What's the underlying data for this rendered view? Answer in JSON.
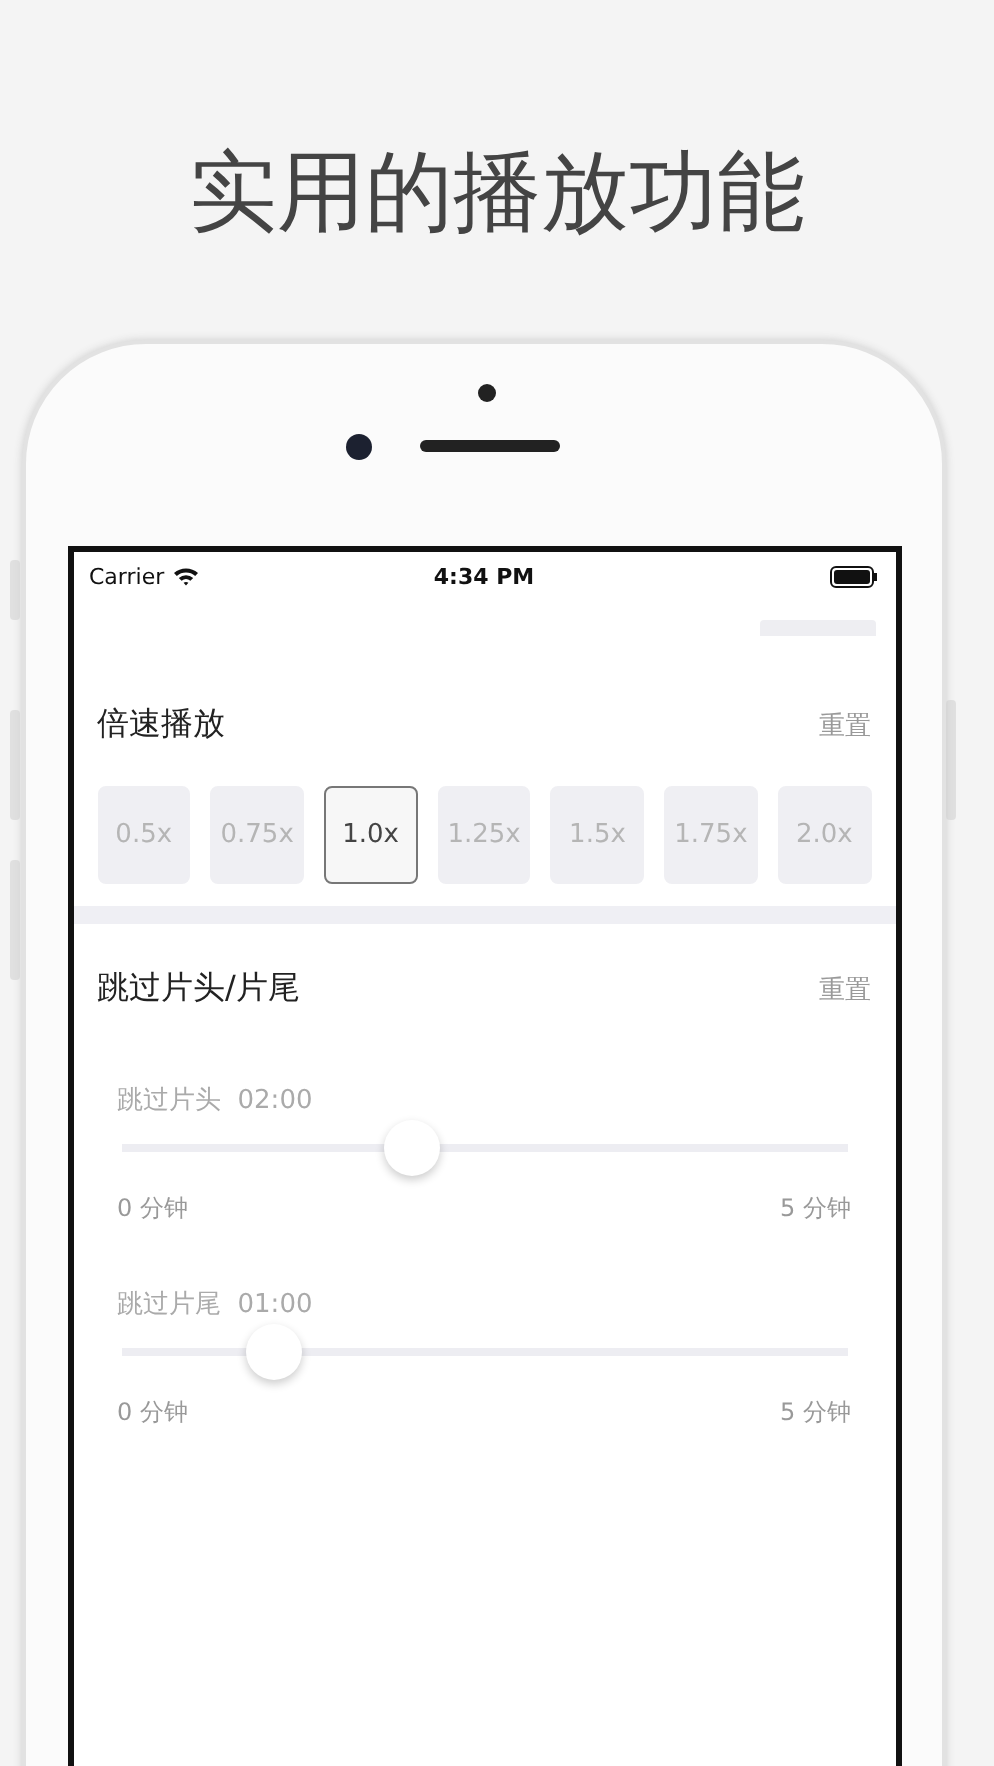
{
  "headline": "实用的播放功能",
  "status_bar": {
    "carrier": "Carrier",
    "time": "4:34 PM"
  },
  "speed": {
    "title": "倍速播放",
    "reset": "重置",
    "options": [
      {
        "label": "0.5x",
        "selected": false
      },
      {
        "label": "0.75x",
        "selected": false
      },
      {
        "label": "1.0x",
        "selected": true
      },
      {
        "label": "1.25x",
        "selected": false
      },
      {
        "label": "1.5x",
        "selected": false
      },
      {
        "label": "1.75x",
        "selected": false
      },
      {
        "label": "2.0x",
        "selected": false
      }
    ]
  },
  "skip": {
    "title": "跳过片头/片尾",
    "reset": "重置",
    "sliders": [
      {
        "label": "跳过片头",
        "value": "02:00",
        "level": 0.4,
        "min_label": "0 分钟",
        "max_label": "5 分钟"
      },
      {
        "label": "跳过片尾",
        "value": "01:00",
        "level": 0.21,
        "min_label": "0 分钟",
        "max_label": "5 分钟"
      }
    ]
  }
}
